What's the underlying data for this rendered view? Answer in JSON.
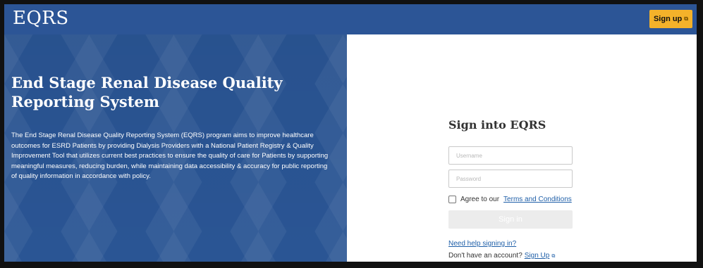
{
  "header": {
    "logo_text": "EQRS",
    "signup_label": "Sign up",
    "signup_icon": "external-link-icon"
  },
  "hero": {
    "title": "End Stage Renal Disease Quality Reporting System",
    "description": "The End Stage Renal Disease Quality Reporting System (EQRS) program aims to improve healthcare outcomes for ESRD Patients by providing Dialysis Providers with a National Patient Registry & Quality Improvement Tool that utilizes current best practices to ensure the quality of care for Patients by supporting meaningful measures, reducing burden, while maintaining data accessibility & accuracy for public reporting of quality information in accordance with policy."
  },
  "login": {
    "title": "Sign into EQRS",
    "username_placeholder": "Username",
    "password_placeholder": "Password",
    "agree_prefix": "Agree to our",
    "terms_link": "Terms and Conditions",
    "signin_label": "Sign in",
    "help_link": "Need help signing in?",
    "no_account_text": "Don't have an account?",
    "signup_link": "Sign Up",
    "signup_link_icon": "external-link-icon"
  },
  "colors": {
    "brand_blue": "#2c5596",
    "signup_yellow": "#f4b22a",
    "link_blue": "#1f5fa8"
  }
}
